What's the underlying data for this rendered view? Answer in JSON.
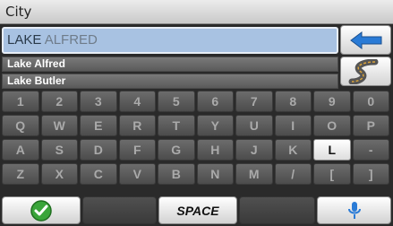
{
  "header": {
    "title": "City"
  },
  "search": {
    "typed": "LAKE",
    "completion": " ALFRED"
  },
  "results": [
    {
      "label": "Lake Alfred"
    },
    {
      "label": "Lake Butler"
    }
  ],
  "keyboard": {
    "rows": [
      [
        "1",
        "2",
        "3",
        "4",
        "5",
        "6",
        "7",
        "8",
        "9",
        "0"
      ],
      [
        "Q",
        "W",
        "E",
        "R",
        "T",
        "Y",
        "U",
        "I",
        "O",
        "P"
      ],
      [
        "A",
        "S",
        "D",
        "F",
        "G",
        "H",
        "J",
        "K",
        "L",
        "-"
      ],
      [
        "Z",
        "X",
        "C",
        "V",
        "B",
        "N",
        "M",
        "/",
        "[",
        "]"
      ]
    ],
    "active_key": "L"
  },
  "bottom": {
    "space_label": "SPACE"
  },
  "icons": {
    "back": "back-arrow-icon",
    "route": "road-route-icon",
    "ok": "check-icon",
    "voice": "microphone-icon"
  },
  "colors": {
    "search_bg": "#a8c2e2",
    "accent_blue": "#2a7bd6",
    "ok_green": "#3aa53a",
    "key_dark": "#5a5a5a",
    "key_active": "#ffffff"
  }
}
